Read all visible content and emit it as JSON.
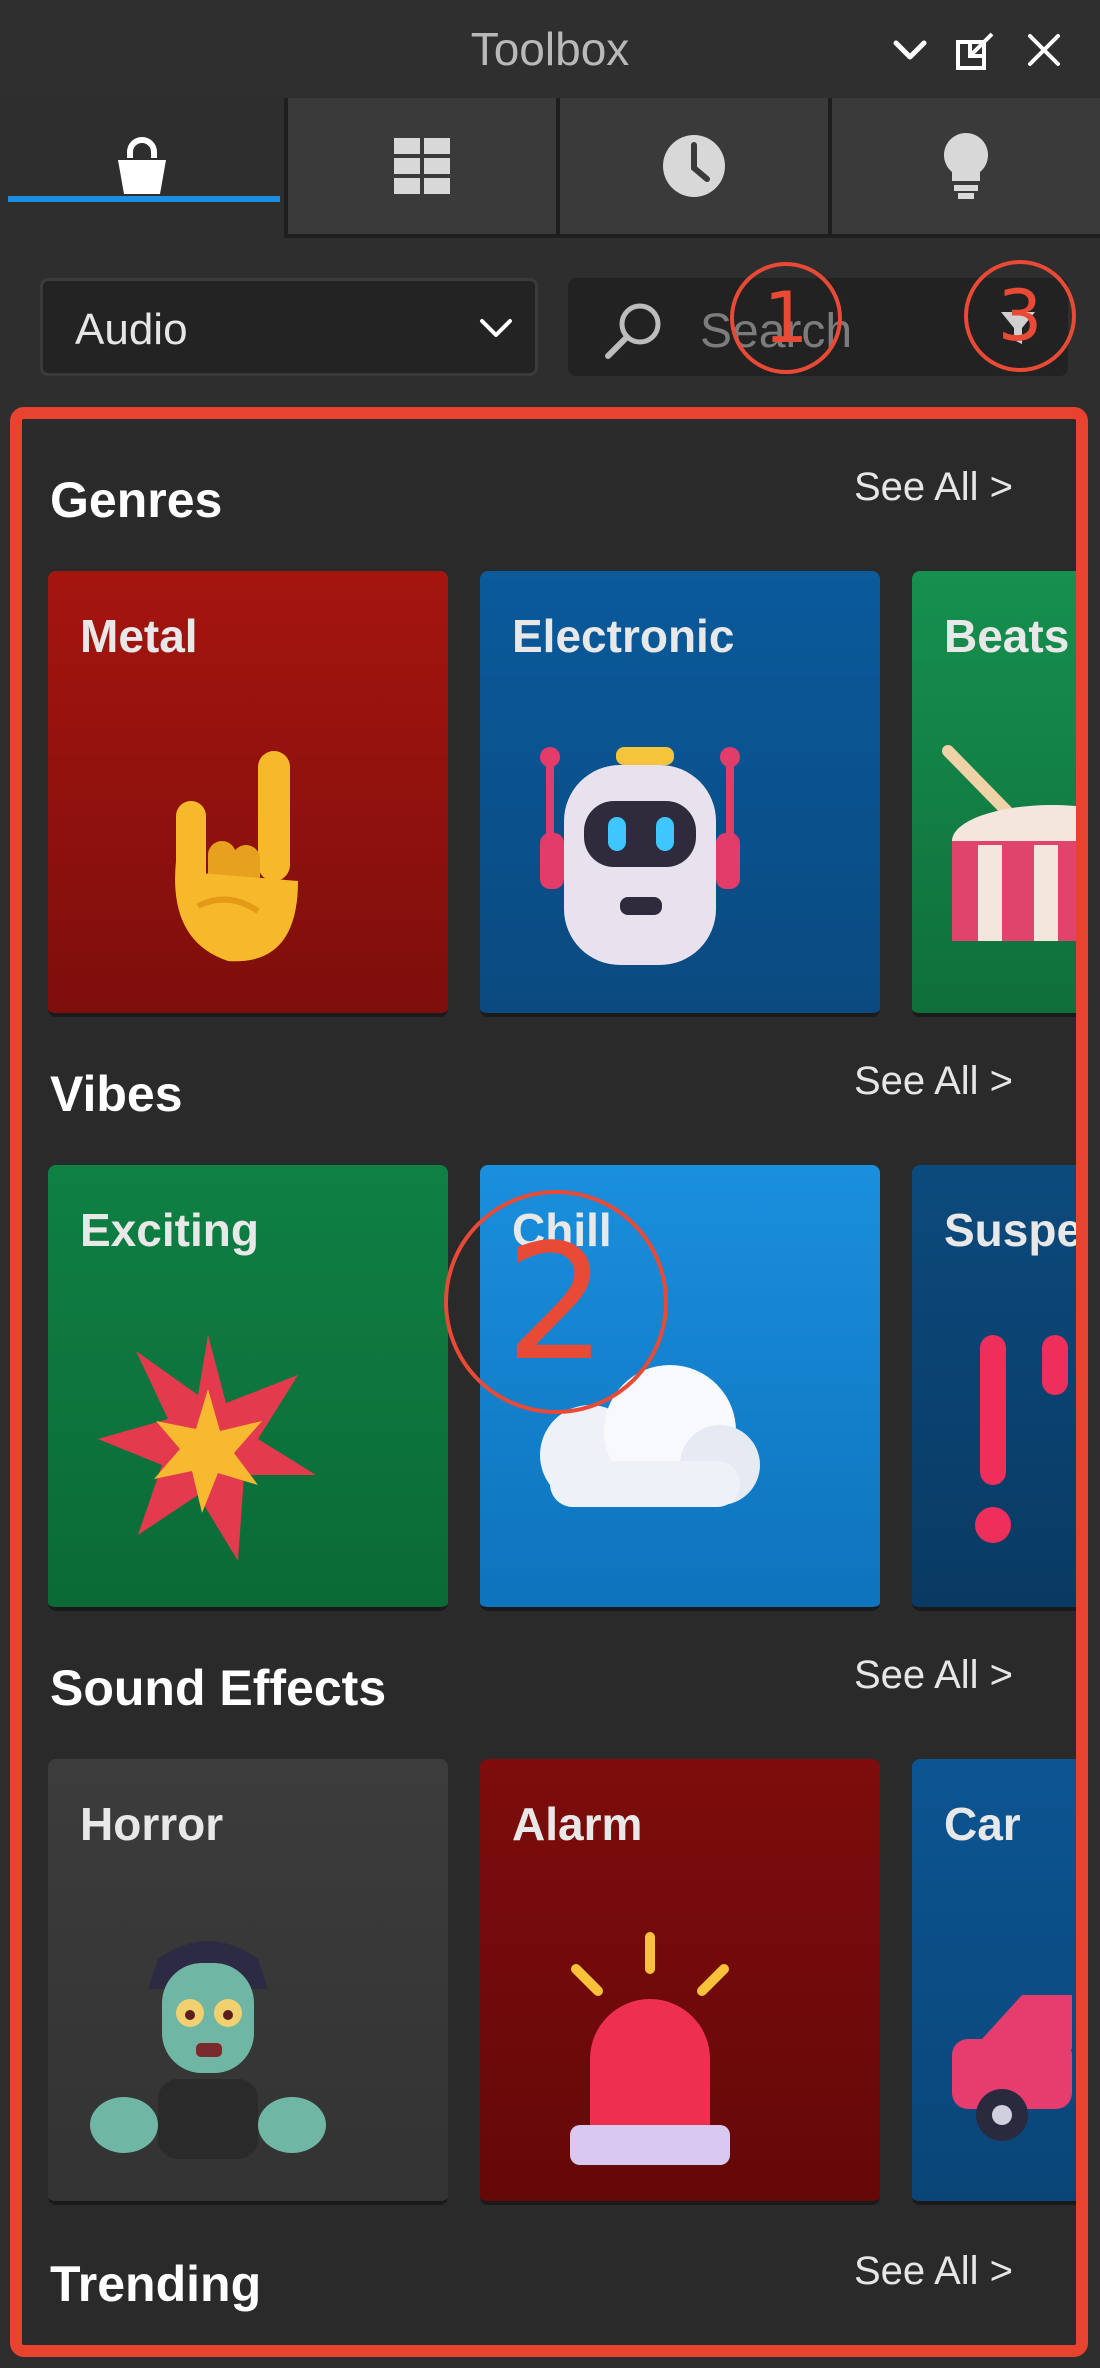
{
  "titlebar": {
    "title": "Toolbox"
  },
  "tabs": [
    {
      "name": "marketplace",
      "icon": "shopping-bag-icon",
      "active": true
    },
    {
      "name": "inventory",
      "icon": "grid-icon",
      "active": false
    },
    {
      "name": "recent",
      "icon": "clock-icon",
      "active": false
    },
    {
      "name": "creations",
      "icon": "lightbulb-icon",
      "active": false
    }
  ],
  "toolbar": {
    "category": "Audio",
    "search_placeholder": "Search"
  },
  "annotations": {
    "one": "1",
    "two": "2",
    "three": "3"
  },
  "sections": [
    {
      "title": "Genres",
      "see_all": "See All >",
      "cards": [
        {
          "label": "Metal",
          "icon": "rock-hand-icon",
          "color": "#a5150f"
        },
        {
          "label": "Electronic",
          "icon": "robot-icon",
          "color": "#0a5a9c"
        },
        {
          "label": "Beats",
          "icon": "drum-icon",
          "color": "#13844a"
        }
      ]
    },
    {
      "title": "Vibes",
      "see_all": "See All >",
      "cards": [
        {
          "label": "Exciting",
          "icon": "explosion-icon",
          "color": "#0f8044"
        },
        {
          "label": "Chill",
          "icon": "cloud-icon",
          "color": "#168ad6"
        },
        {
          "label": "Suspe",
          "icon": "exclamation-icon",
          "color": "#0b4472"
        }
      ]
    },
    {
      "title": "Sound Effects",
      "see_all": "See All >",
      "cards": [
        {
          "label": "Horror",
          "icon": "zombie-icon",
          "color": "#3a3a3a"
        },
        {
          "label": "Alarm",
          "icon": "siren-icon",
          "color": "#780c0c"
        },
        {
          "label": "Car",
          "icon": "car-icon",
          "color": "#0b4f88"
        }
      ]
    },
    {
      "title": "Trending",
      "see_all": "See All >"
    }
  ]
}
